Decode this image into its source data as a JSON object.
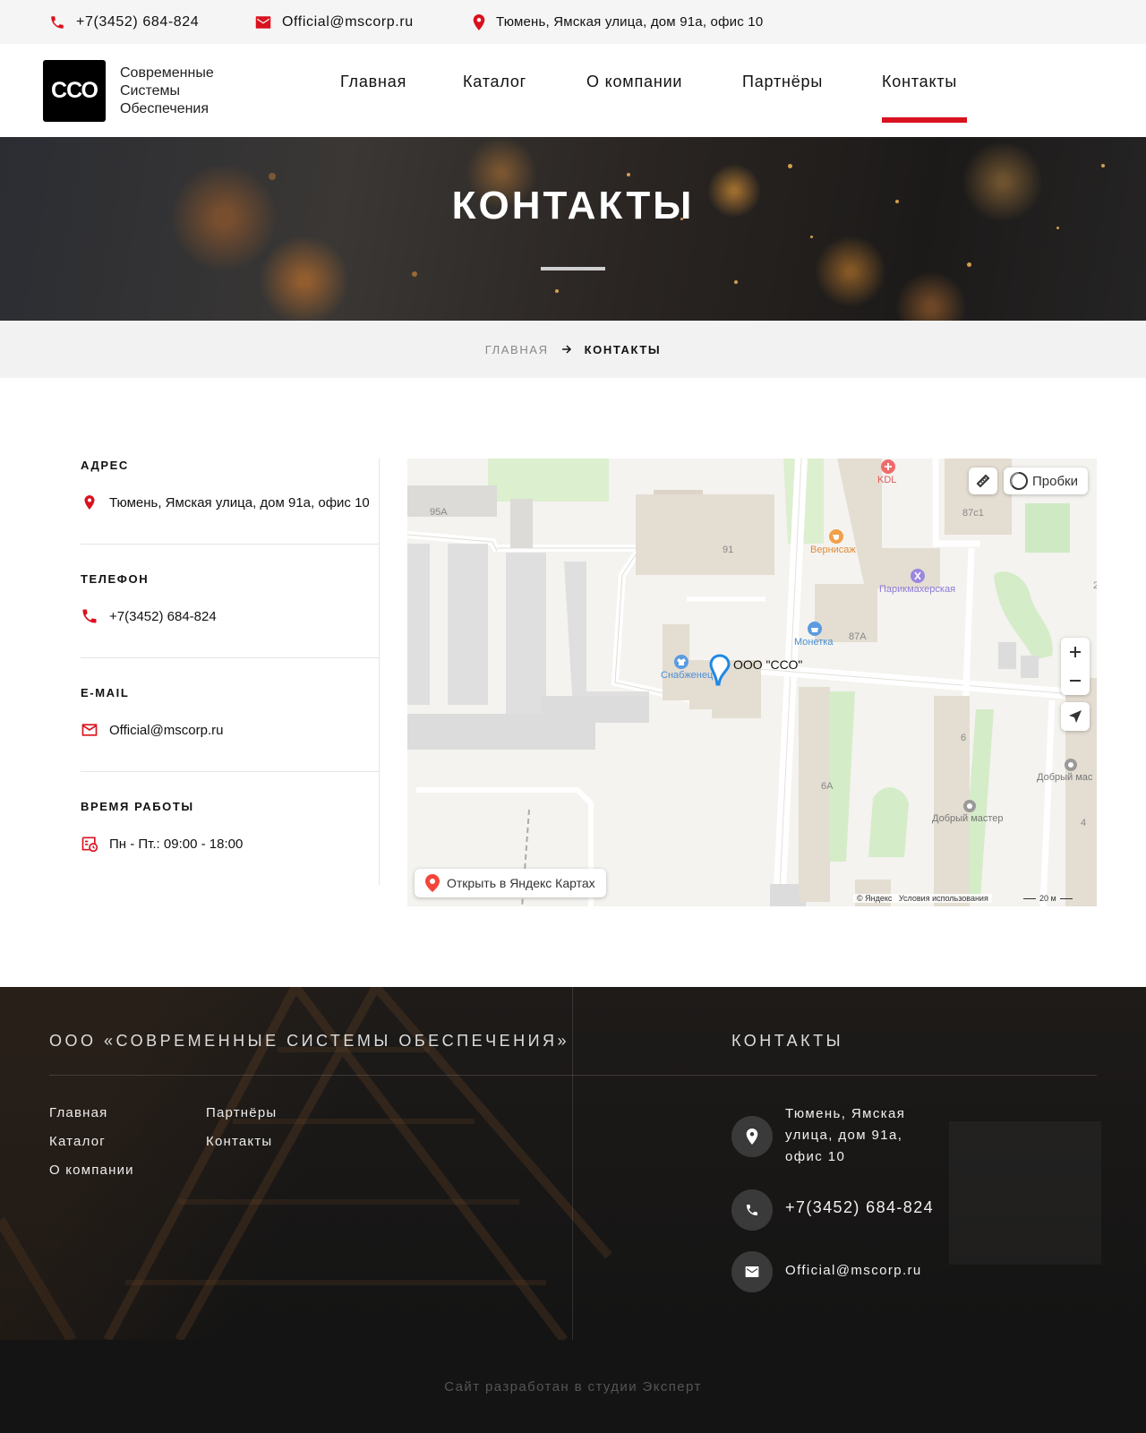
{
  "topbar": {
    "phone": "+7(3452) 684-824",
    "email": "Official@mscorp.ru",
    "address": "Тюмень, Ямская улица, дом 91а, офис 10"
  },
  "logo": {
    "mark": "ССО",
    "line1": "Современные",
    "line2": "Системы",
    "line3": "Обеспечения"
  },
  "nav": {
    "items": [
      "Главная",
      "Каталог",
      "О компании",
      "Партнёры",
      "Контакты"
    ],
    "active": "Контакты"
  },
  "hero": {
    "title": "КОНТАКТЫ"
  },
  "breadcrumb": {
    "home": "ГЛАВНАЯ",
    "current": "КОНТАКТЫ"
  },
  "contacts": {
    "address_label": "АДРЕС",
    "address": "Тюмень, Ямская улица, дом 91а, офис 10",
    "phone_label": "ТЕЛЕФОН",
    "phone": "+7(3452) 684-824",
    "email_label": "E-MAIL",
    "email": "Official@mscorp.ru",
    "hours_label": "ВРЕМЯ РАБОТЫ",
    "hours": "Пн - Пт.: 09:00 - 18:00"
  },
  "map": {
    "traffic": "Пробки",
    "open_in_maps": "Открыть в Яндекс Картах",
    "marker": "ООО \"ССО\"",
    "copyright": "© Яндекс",
    "terms": "Условия использования",
    "scale": "20 м",
    "labels": {
      "b95a": "95А",
      "b91": "91",
      "b87c1": "87с1",
      "b87a": "87А",
      "b6": "6",
      "b6a": "6А",
      "b4": "4",
      "b2": "2",
      "kdl": "KDL",
      "vernisazh": "Вернисаж",
      "parikmakherskaya": "Парикмахерская",
      "monetka": "Монетка",
      "snabzhenets": "Снабженец",
      "dobry_master": "Добрый мастер",
      "dobry_mas_cut": "Добрый мас"
    },
    "accent": "#d9121f"
  },
  "footer": {
    "company": "ООО «СОВРЕМЕННЫЕ СИСТЕМЫ ОБЕСПЕЧЕНИЯ»",
    "links": [
      "Главная",
      "Каталог",
      "О компании",
      "Партнёры",
      "Контакты"
    ],
    "contacts_title": "КОНТАКТЫ",
    "address_l1": "Тюмень, Ямская",
    "address_l2": "улица, дом 91а,",
    "address_l3": "офис 10",
    "phone": "+7(3452) 684-824",
    "email": "Official@mscorp.ru"
  },
  "bottom": {
    "credit": "Сайт разработан в студии Эксперт"
  }
}
